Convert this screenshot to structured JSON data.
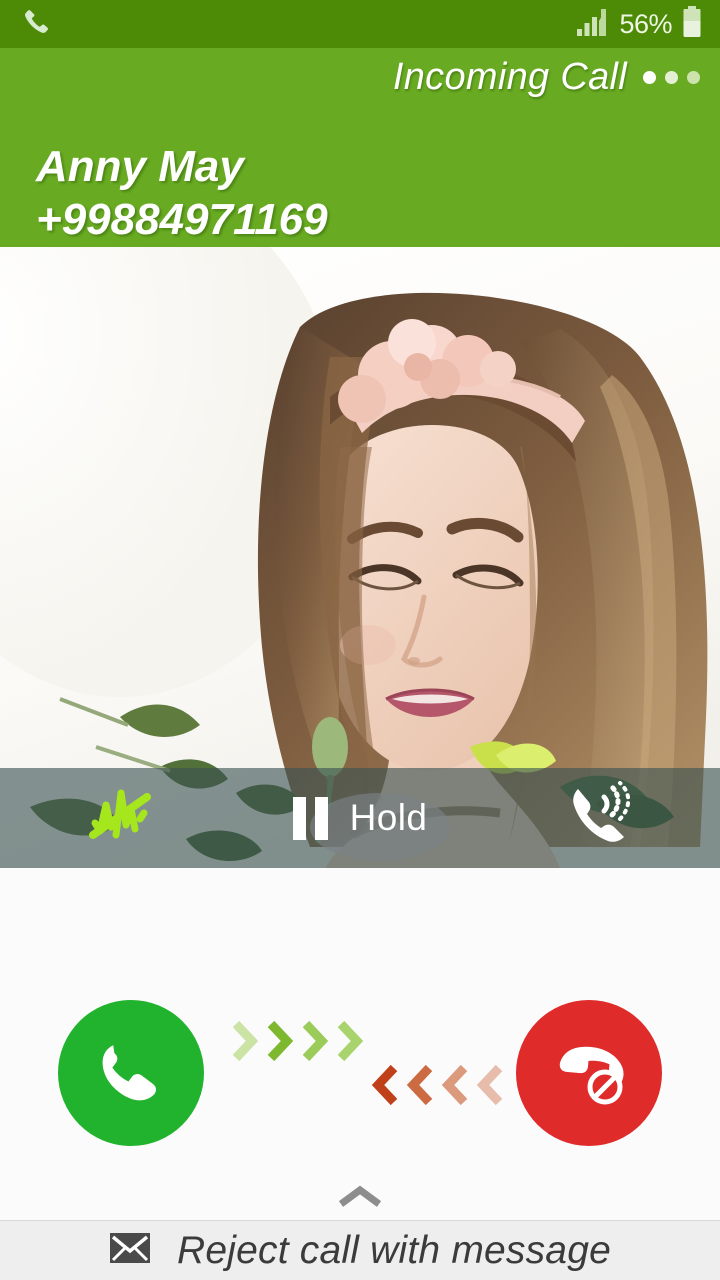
{
  "status_bar": {
    "call_icon": "phone-handset-icon",
    "signal_icon": "signal-bars-icon",
    "battery_percent": "56%",
    "battery_icon": "battery-icon"
  },
  "header": {
    "state_label": "Incoming Call",
    "overflow_menu": "more-options-icon",
    "contact_name": "Anny May",
    "contact_number": "+99884971169",
    "background_color": "#68ab22",
    "status_background_color": "#4d8b07"
  },
  "photo": {
    "description": "contact-photo",
    "alt": "Portrait of a young woman with long brown hair and a pink floral headband looking down, bright white background with flowers"
  },
  "control_bar": {
    "noise_icon": "noise-cancel-waveform-icon",
    "noise_icon_color": "#a6e61d",
    "hold_icon": "pause-icon",
    "hold_label": "Hold",
    "speaker_icon": "phone-ringing-icon"
  },
  "actions": {
    "answer": {
      "icon": "answer-call-icon",
      "color": "#22b32e",
      "hint_icon": "chevron-right-icon",
      "hint_colors": [
        "#c7e2a0",
        "#8cc63f",
        "#a9d66b",
        "#bcdd8b"
      ]
    },
    "reject": {
      "icon": "reject-call-icon",
      "color": "#e02b2b",
      "hint_icon": "chevron-left-icon",
      "hint_colors": [
        "#c0401a",
        "#cf6a44",
        "#dd9a7e",
        "#e8bcab"
      ]
    }
  },
  "drawer": {
    "handle_icon": "chevron-up-icon",
    "message_icon": "envelope-icon",
    "message_label": "Reject call with message"
  }
}
